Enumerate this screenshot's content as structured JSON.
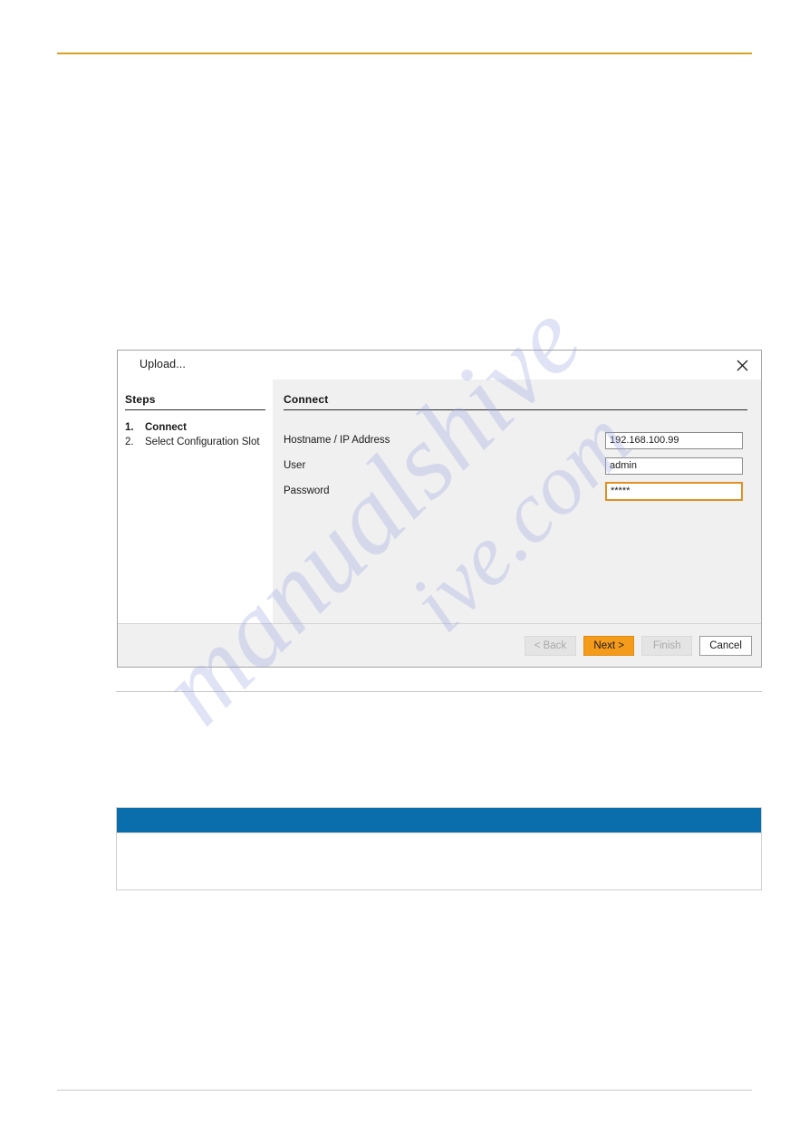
{
  "page": {
    "watermark_line1": "manualshive",
    "watermark_line2": "ive.com",
    "header_rule_color": "#D9A022",
    "footer_rule_color": "#C9C9C9"
  },
  "note_box": {
    "header_color": "#0A6EAD",
    "header_text": "",
    "body_text": ""
  },
  "dialog": {
    "title": "Upload...",
    "close_icon": "close-icon",
    "steps": {
      "heading": "Steps",
      "items": [
        {
          "number": "1.",
          "label": "Connect",
          "current": true
        },
        {
          "number": "2.",
          "label": "Select Configuration Slot",
          "current": false
        }
      ]
    },
    "content": {
      "heading": "Connect",
      "fields": [
        {
          "label": "Hostname / IP Address",
          "value": "192.168.100.99",
          "placeholder": "",
          "focused": false,
          "type": "text"
        },
        {
          "label": "User",
          "value": "admin",
          "placeholder": "",
          "focused": false,
          "type": "text"
        },
        {
          "label": "Password",
          "value": "*****",
          "placeholder": "",
          "focused": true,
          "type": "password"
        }
      ]
    },
    "buttons": {
      "back": {
        "label": "< Back",
        "disabled": true
      },
      "next": {
        "label": "Next >",
        "disabled": false,
        "primary": true,
        "color": "#F59B1C"
      },
      "finish": {
        "label": "Finish",
        "disabled": true
      },
      "cancel": {
        "label": "Cancel",
        "disabled": false
      }
    }
  }
}
